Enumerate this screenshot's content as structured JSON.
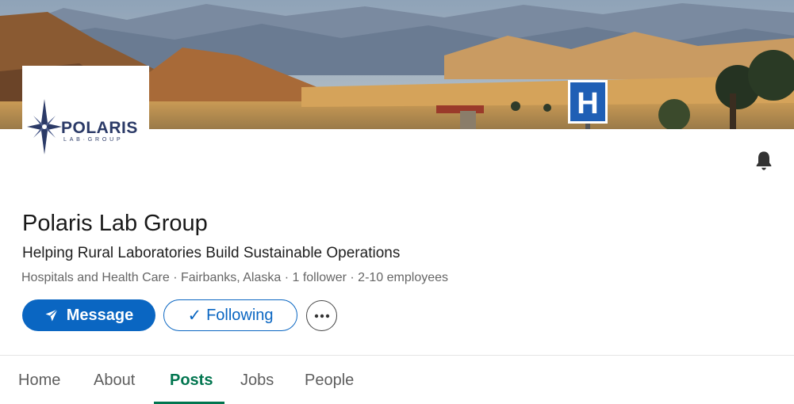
{
  "company": {
    "logo_name": "POLARIS",
    "logo_sub": "LAB·GROUP",
    "name": "Polaris Lab Group",
    "tagline": "Helping Rural Laboratories Build Sustainable Operations",
    "meta": "Hospitals and Health Care · Fairbanks, Alaska · 1 follower · 2-10 employees"
  },
  "banner": {
    "sign_letter": "H"
  },
  "actions": {
    "message_label": "Message",
    "following_label": "Following",
    "following_check": "✓"
  },
  "tabs": [
    {
      "label": "Home",
      "active": false
    },
    {
      "label": "About",
      "active": false
    },
    {
      "label": "Posts",
      "active": true
    },
    {
      "label": "Jobs",
      "active": false
    },
    {
      "label": "People",
      "active": false
    }
  ],
  "colors": {
    "primary": "#0a66c2",
    "active_tab": "#01754f",
    "logo_navy": "#2b3a67"
  },
  "icons": {
    "bell": "bell-icon",
    "message": "send-icon",
    "more": "ellipsis-icon"
  }
}
